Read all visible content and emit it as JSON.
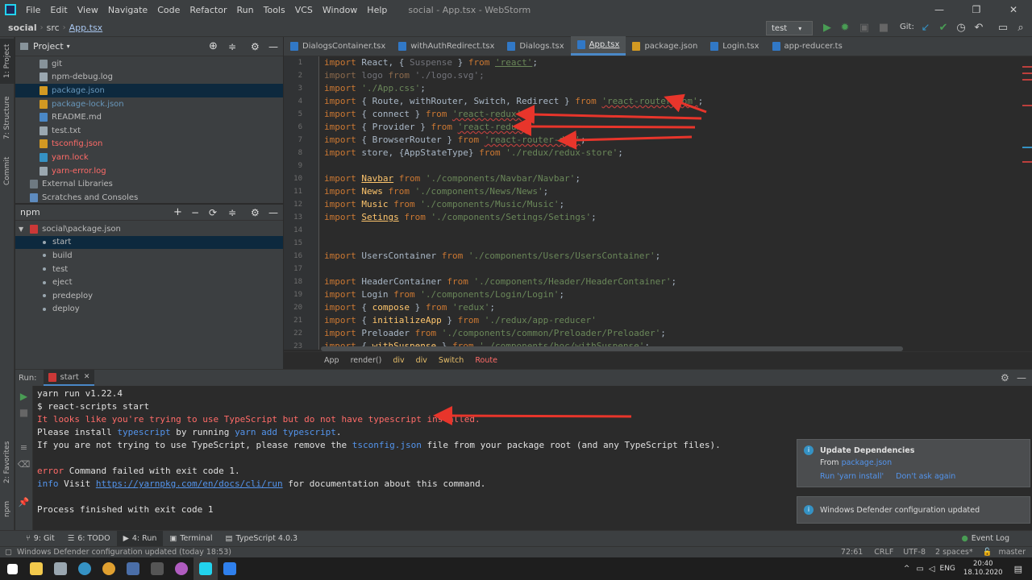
{
  "menubar": {
    "items": [
      "File",
      "Edit",
      "View",
      "Navigate",
      "Code",
      "Refactor",
      "Run",
      "Tools",
      "VCS",
      "Window",
      "Help"
    ],
    "title": "social - App.tsx - WebStorm"
  },
  "navbar": {
    "crumbs": [
      "social",
      "src",
      "App.tsx"
    ],
    "run_config": "test",
    "git_label": "Git:"
  },
  "left_tool_windows": [
    "1: Project",
    "7: Structure",
    "Commit",
    "2: Favorites",
    "npm"
  ],
  "project": {
    "header": "Project",
    "items": [
      {
        "name": "git",
        "color": "#bbbbbb",
        "icon": "folder"
      },
      {
        "name": "npm-debug.log",
        "color": "#bbbbbb",
        "icon": "file"
      },
      {
        "name": "package.json",
        "color": "#6897bb",
        "icon": "file"
      },
      {
        "name": "package-lock.json",
        "color": "#6897bb",
        "icon": "file"
      },
      {
        "name": "README.md",
        "color": "#bbbbbb",
        "icon": "file"
      },
      {
        "name": "test.txt",
        "color": "#bbbbbb",
        "icon": "file"
      },
      {
        "name": "tsconfig.json",
        "color": "#ff6b68",
        "icon": "file"
      },
      {
        "name": "yarn.lock",
        "color": "#ff6b68",
        "icon": "file"
      },
      {
        "name": "yarn-error.log",
        "color": "#ff6b68",
        "icon": "file"
      },
      {
        "name": "External Libraries",
        "color": "#bbbbbb",
        "icon": "lib"
      },
      {
        "name": "Scratches and Consoles",
        "color": "#bbbbbb",
        "icon": "scratch"
      }
    ]
  },
  "npm_panel": {
    "header": "npm",
    "root": "social\\package.json",
    "scripts": [
      "start",
      "build",
      "test",
      "eject",
      "predeploy",
      "deploy"
    ]
  },
  "editor": {
    "tabs": [
      "DialogsContainer.tsx",
      "withAuthRedirect.tsx",
      "Dialogs.tsx",
      "App.tsx",
      "package.json",
      "Login.tsx",
      "app-reducer.ts"
    ],
    "active_tab": "App.tsx",
    "line_numbers": [
      "1",
      "2",
      "3",
      "4",
      "5",
      "6",
      "7",
      "8",
      "9",
      "10",
      "11",
      "12",
      "13",
      "14",
      "15",
      "16",
      "17",
      "18",
      "19",
      "20",
      "21",
      "22",
      "23"
    ],
    "breadcrumb": [
      "App",
      "render()",
      "div",
      "div",
      "Switch",
      "Route"
    ]
  },
  "run_panel": {
    "label": "Run:",
    "tab": "start",
    "lines": [
      "yarn run v1.22.4",
      "$ react-scripts start",
      "It looks like you're trying to use TypeScript but do not have typescript installed.",
      "Please install typescript by running yarn add typescript.",
      "If you are not trying to use TypeScript, please remove the tsconfig.json file from your package root (and any TypeScript files).",
      "",
      "error Command failed with exit code 1.",
      "info Visit https://yarnpkg.com/en/docs/cli/run for documentation about this command.",
      "",
      "Process finished with exit code 1"
    ]
  },
  "notifications": {
    "update_title": "Update Dependencies",
    "update_from": "From",
    "update_file": "package.json",
    "run_yarn": "Run 'yarn install'",
    "dont_ask": "Don't ask again",
    "defender": "Windows Defender configuration updated"
  },
  "bottom_tabs": [
    "9: Git",
    "6: TODO",
    "4: Run",
    "Terminal",
    "TypeScript 4.0.3"
  ],
  "event_log": "Event Log",
  "status": {
    "message": "Windows Defender configuration updated (today 18:53)",
    "position": "72:61",
    "line_sep": "CRLF",
    "encoding": "UTF-8",
    "indent": "2 spaces*",
    "branch": "master"
  },
  "taskbar": {
    "lang": "ENG",
    "time": "20:40",
    "date": "18.10.2020"
  }
}
